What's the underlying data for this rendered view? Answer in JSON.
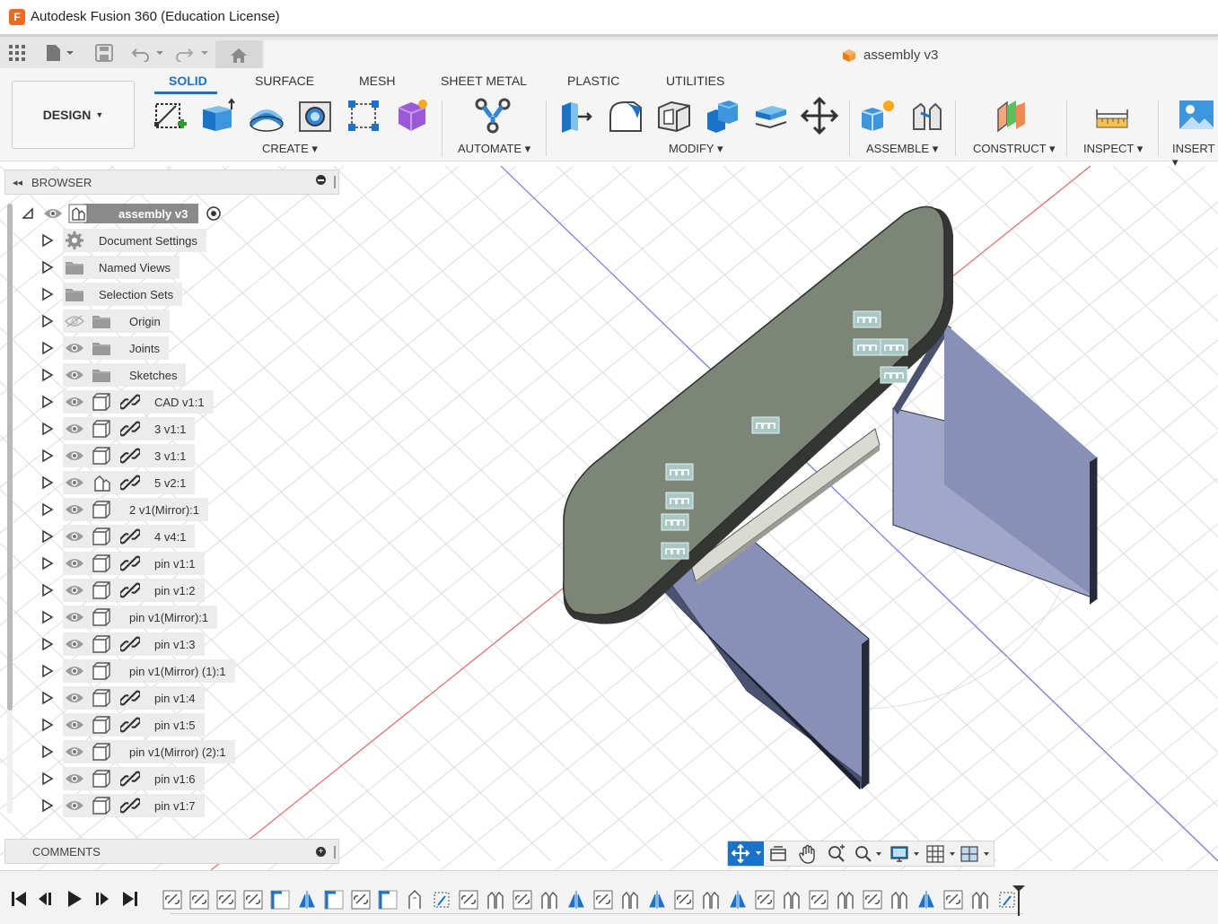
{
  "window": {
    "title": "Autodesk Fusion 360 (Education License)",
    "app_icon_letter": "F"
  },
  "document": {
    "title": "assembly v3"
  },
  "workspace": {
    "design_label": "DESIGN"
  },
  "ribbon": {
    "tabs": [
      "SOLID",
      "SURFACE",
      "MESH",
      "SHEET METAL",
      "PLASTIC",
      "UTILITIES"
    ],
    "active_tab": "SOLID",
    "groups": [
      "CREATE",
      "AUTOMATE",
      "MODIFY",
      "ASSEMBLE",
      "CONSTRUCT",
      "INSPECT",
      "INSERT"
    ]
  },
  "browser": {
    "title": "BROWSER",
    "root": "assembly v3",
    "items": [
      {
        "label": "Document Settings",
        "kind": "settings"
      },
      {
        "label": "Named Views",
        "kind": "folder"
      },
      {
        "label": "Selection Sets",
        "kind": "folder"
      },
      {
        "label": "Origin",
        "kind": "folder-hidden"
      },
      {
        "label": "Joints",
        "kind": "folder-eye"
      },
      {
        "label": "Sketches",
        "kind": "folder-eye"
      },
      {
        "label": "CAD v1:1",
        "kind": "component-link"
      },
      {
        "label": "3 v1:1",
        "kind": "component-link"
      },
      {
        "label": "3 v1:1",
        "kind": "component-link"
      },
      {
        "label": "5 v2:1",
        "kind": "assembly-link"
      },
      {
        "label": "2 v1(Mirror):1",
        "kind": "component"
      },
      {
        "label": "4 v4:1",
        "kind": "component-link"
      },
      {
        "label": "pin v1:1",
        "kind": "component-link"
      },
      {
        "label": "pin v1:2",
        "kind": "component-link"
      },
      {
        "label": "pin v1(Mirror):1",
        "kind": "component"
      },
      {
        "label": "pin v1:3",
        "kind": "component-link"
      },
      {
        "label": "pin v1(Mirror) (1):1",
        "kind": "component"
      },
      {
        "label": "pin v1:4",
        "kind": "component-link"
      },
      {
        "label": "pin v1:5",
        "kind": "component-link"
      },
      {
        "label": "pin v1(Mirror) (2):1",
        "kind": "component"
      },
      {
        "label": "pin v1:6",
        "kind": "component-link"
      },
      {
        "label": "pin v1:7",
        "kind": "component-link"
      }
    ]
  },
  "comments": {
    "title": "COMMENTS"
  },
  "colors": {
    "accent": "#1a73c8",
    "tabletop": "#7d8478",
    "legs": "#5a6384",
    "axis_red": "#e06060",
    "axis_blue": "#6a6adf"
  },
  "timeline": {
    "feature_icons": [
      "joint",
      "joint",
      "joint",
      "joint",
      "sketch",
      "mirror",
      "sketch",
      "joint",
      "sketch",
      "rigid",
      "plane",
      "joint",
      "revolute",
      "joint",
      "revolute",
      "mirror",
      "joint",
      "revolute",
      "mirror",
      "joint",
      "revolute",
      "mirror",
      "joint",
      "revolute",
      "joint",
      "revolute",
      "joint",
      "revolute",
      "mirror",
      "joint",
      "revolute",
      "plane"
    ]
  }
}
